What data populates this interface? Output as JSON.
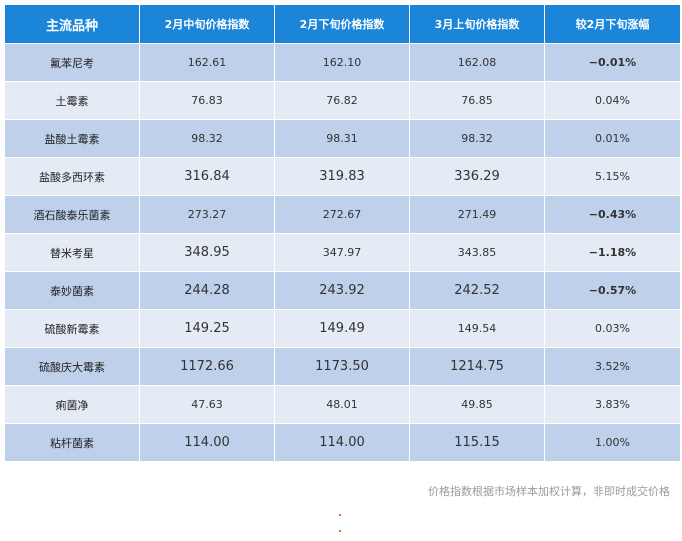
{
  "table": {
    "headers": [
      "主流品种",
      "2月中旬价格指数",
      "2月下旬价格指数",
      "3月上旬价格指数",
      "较2月下旬涨幅"
    ],
    "rows": [
      {
        "name": "氟苯尼考",
        "c1": "162.61",
        "c2": "162.10",
        "c3": "162.08",
        "chg": "−0.01%"
      },
      {
        "name": "土霉素",
        "c1": "76.83",
        "c2": "76.82",
        "c3": "76.85",
        "chg": "0.04%"
      },
      {
        "name": "盐酸土霉素",
        "c1": "98.32",
        "c2": "98.31",
        "c3": "98.32",
        "chg": "0.01%"
      },
      {
        "name": "盐酸多西环素",
        "c1": "316.84",
        "c2": "319.83",
        "c3": "336.29",
        "chg": "5.15%"
      },
      {
        "name": "酒石酸泰乐菌素",
        "c1": "273.27",
        "c2": "272.67",
        "c3": "271.49",
        "chg": "−0.43%"
      },
      {
        "name": "替米考星",
        "c1": "348.95",
        "c2": "347.97",
        "c3": "343.85",
        "chg": "−1.18%"
      },
      {
        "name": "泰妙菌素",
        "c1": "244.28",
        "c2": "243.92",
        "c3": "242.52",
        "chg": "−0.57%"
      },
      {
        "name": "硫酸新霉素",
        "c1": "149.25",
        "c2": "149.49",
        "c3": "149.54",
        "chg": "0.03%"
      },
      {
        "name": "硫酸庆大霉素",
        "c1": "1172.66",
        "c2": "1173.50",
        "c3": "1214.75",
        "chg": "3.52%"
      },
      {
        "name": "痢菌净",
        "c1": "47.63",
        "c2": "48.01",
        "c3": "49.85",
        "chg": "3.83%"
      },
      {
        "name": "粘杆菌素",
        "c1": "114.00",
        "c2": "114.00",
        "c3": "115.15",
        "chg": "1.00%"
      }
    ]
  },
  "note": "价格指数根据市场样本加权计算，非即时成交价格",
  "colors": {
    "header_bg": "#1a85d9",
    "row_dark": "#bed0ea",
    "row_light": "#e4ebf5",
    "rise": "#e8283a",
    "fall": "#2e7d2e"
  }
}
